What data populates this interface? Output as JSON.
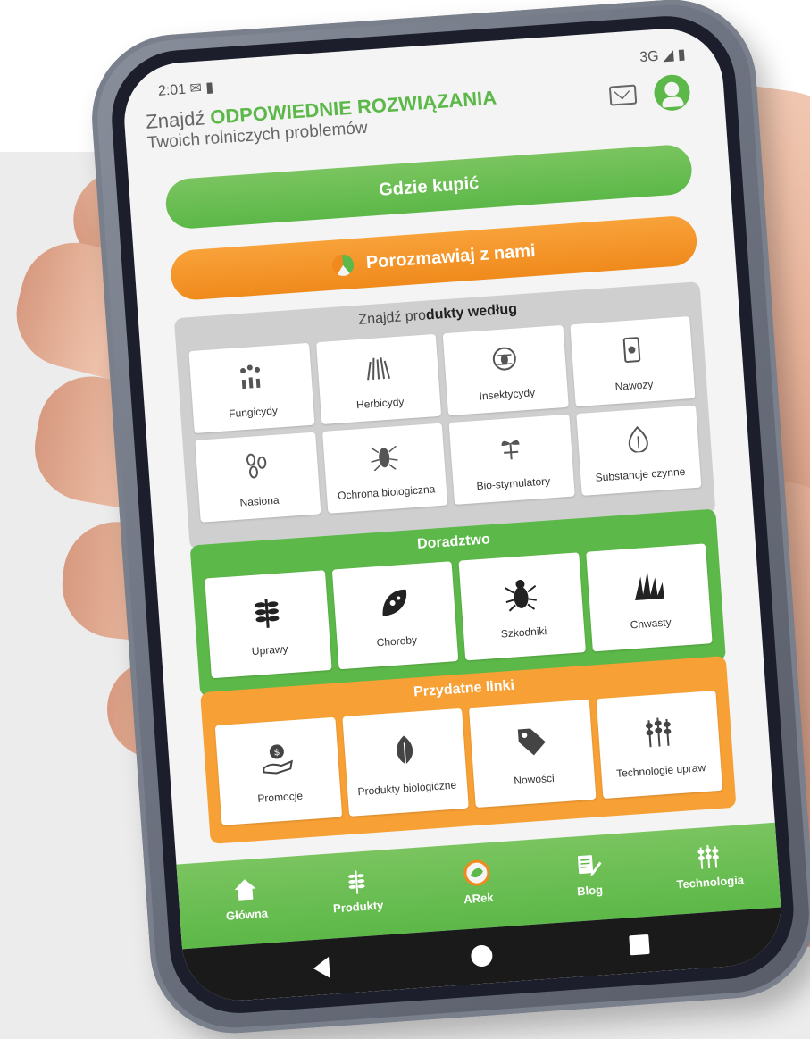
{
  "status_bar": {
    "time": "2:01",
    "left_icons": "✉ ▮",
    "network": "3G ◢ ▮"
  },
  "header": {
    "tagline_prefix": "Znajdź ",
    "tagline_highlight": "ODPOWIEDNIE ROZWIĄZANIA",
    "tagline_sub": "Twoich rolniczych problemów"
  },
  "buttons": {
    "where_to_buy": "Gdzie kupić",
    "chat": "Porozmawiaj z nami"
  },
  "products_section": {
    "title_prefix": "Znajdź pro",
    "title_bold": "dukty według",
    "tiles": [
      {
        "label": "Fungicydy",
        "icon": "fungicide-icon"
      },
      {
        "label": "Herbicydy",
        "icon": "herbicide-icon"
      },
      {
        "label": "Insektycydy",
        "icon": "insecticide-icon"
      },
      {
        "label": "Nawozy",
        "icon": "fertilizer-icon"
      },
      {
        "label": "Nasiona",
        "icon": "seeds-icon"
      },
      {
        "label": "Ochrona biologiczna",
        "icon": "cockroach-icon"
      },
      {
        "label": "Bio-stymulatory",
        "icon": "sprout-icon"
      },
      {
        "label": "Substancje czynne",
        "icon": "leaf-drop-icon"
      }
    ]
  },
  "advisory_section": {
    "title": "Doradztwo",
    "tiles": [
      {
        "label": "Uprawy",
        "icon": "wheat-icon"
      },
      {
        "label": "Choroby",
        "icon": "diseased-leaf-icon"
      },
      {
        "label": "Szkodniki",
        "icon": "beetle-icon"
      },
      {
        "label": "Chwasty",
        "icon": "weeds-icon"
      }
    ]
  },
  "links_section": {
    "title": "Przydatne linki",
    "tiles": [
      {
        "label": "Promocje",
        "icon": "coin-hand-icon"
      },
      {
        "label": "Produkty biologiczne",
        "icon": "leaf-icon"
      },
      {
        "label": "Nowości",
        "icon": "tag-icon"
      },
      {
        "label": "Technologie upraw",
        "icon": "crop-field-icon"
      }
    ]
  },
  "bottom_nav": [
    {
      "label": "Główna",
      "icon": "home-icon"
    },
    {
      "label": "Produkty",
      "icon": "wheat-icon"
    },
    {
      "label": "ARek",
      "icon": "arek-logo-icon"
    },
    {
      "label": "Blog",
      "icon": "blog-icon"
    },
    {
      "label": "Technologia",
      "icon": "crop-field-icon"
    }
  ],
  "colors": {
    "green": "#5cb848",
    "orange": "#f08a1c",
    "grey_section": "#cfcfcf",
    "phone_case": "#6f7482"
  }
}
